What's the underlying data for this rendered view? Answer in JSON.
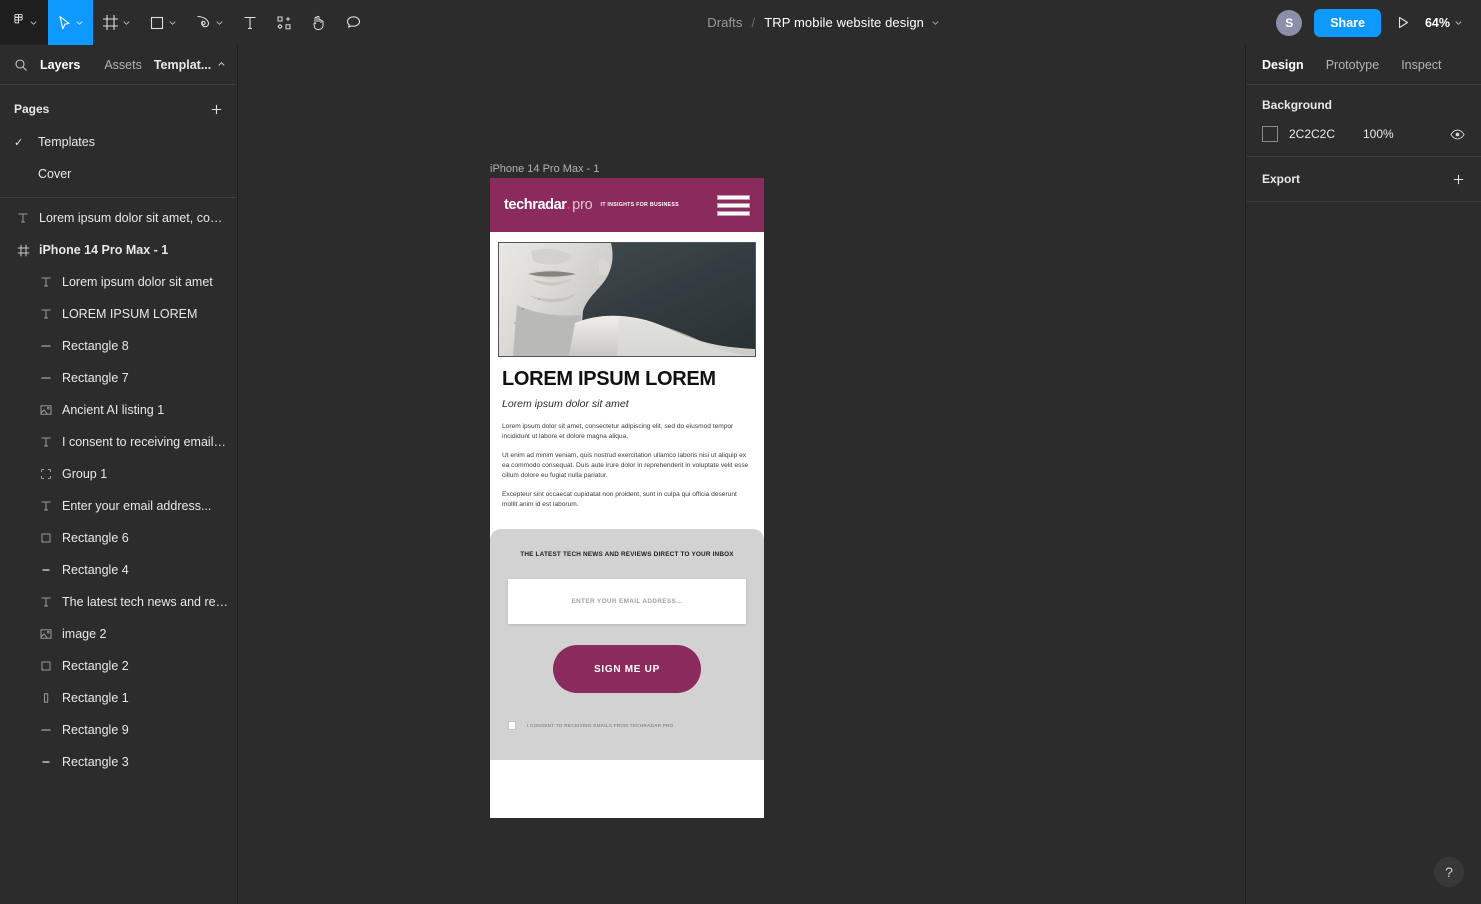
{
  "toolbar": {
    "tools": [
      {
        "name": "figma-menu-icon",
        "label": "Figma menu"
      },
      {
        "name": "move-tool-icon",
        "label": "Move"
      },
      {
        "name": "frame-tool-icon",
        "label": "Frame"
      },
      {
        "name": "shape-tool-icon",
        "label": "Rectangle"
      },
      {
        "name": "pen-tool-icon",
        "label": "Pen"
      },
      {
        "name": "text-tool-icon",
        "label": "Text"
      },
      {
        "name": "resources-icon",
        "label": "Resources"
      },
      {
        "name": "hand-tool-icon",
        "label": "Hand"
      },
      {
        "name": "comment-tool-icon",
        "label": "Comment"
      }
    ],
    "breadcrumb_root": "Drafts",
    "breadcrumb_separator": "/",
    "file_name": "TRP mobile website design",
    "avatar_initial": "S",
    "share_label": "Share",
    "zoom_level": "64%",
    "accent_color": "#0d99ff"
  },
  "left_panel": {
    "tabs": [
      {
        "label": "Layers",
        "active": true
      },
      {
        "label": "Assets",
        "active": false
      }
    ],
    "template_tab": "Templat...",
    "pages_title": "Pages",
    "pages": [
      {
        "label": "Templates",
        "selected": true
      },
      {
        "label": "Cover",
        "selected": false
      }
    ],
    "layers": [
      {
        "label": "Lorem ipsum dolor sit amet, conse...",
        "icon": "text-layer-icon",
        "depth": 0,
        "bold": false
      },
      {
        "label": "iPhone 14 Pro Max - 1",
        "icon": "frame-layer-icon",
        "depth": 0,
        "bold": true
      },
      {
        "label": "Lorem ipsum dolor sit amet",
        "icon": "text-layer-icon",
        "depth": 1,
        "bold": false
      },
      {
        "label": "LOREM IPSUM LOREM",
        "icon": "text-layer-icon",
        "depth": 1,
        "bold": false
      },
      {
        "label": "Rectangle 8",
        "icon": "line-layer-icon",
        "depth": 1,
        "bold": false
      },
      {
        "label": "Rectangle 7",
        "icon": "line-layer-icon",
        "depth": 1,
        "bold": false
      },
      {
        "label": "Ancient AI listing 1",
        "icon": "image-layer-icon",
        "depth": 1,
        "bold": false
      },
      {
        "label": "I consent to receiving emails ...",
        "icon": "text-layer-icon",
        "depth": 1,
        "bold": false
      },
      {
        "label": "Group 1",
        "icon": "group-layer-icon",
        "depth": 1,
        "bold": false
      },
      {
        "label": "Enter your email address...",
        "icon": "text-layer-icon",
        "depth": 1,
        "bold": false
      },
      {
        "label": "Rectangle 6",
        "icon": "rect-layer-icon",
        "depth": 1,
        "bold": false
      },
      {
        "label": "Rectangle 4",
        "icon": "line-layer-icon",
        "depth": 1,
        "bold": false
      },
      {
        "label": "The latest tech news and revi...",
        "icon": "text-layer-icon",
        "depth": 1,
        "bold": false
      },
      {
        "label": "image 2",
        "icon": "image-layer-icon",
        "depth": 1,
        "bold": false
      },
      {
        "label": "Rectangle 2",
        "icon": "rect-layer-icon",
        "depth": 1,
        "bold": false
      },
      {
        "label": "Rectangle 1",
        "icon": "tallrect-layer-icon",
        "depth": 1,
        "bold": false
      },
      {
        "label": "Rectangle 9",
        "icon": "line-layer-icon",
        "depth": 1,
        "bold": false
      },
      {
        "label": "Rectangle 3",
        "icon": "line-layer-icon",
        "depth": 1,
        "bold": false
      }
    ]
  },
  "right_panel": {
    "tabs": [
      {
        "label": "Design",
        "active": true
      },
      {
        "label": "Prototype",
        "active": false
      },
      {
        "label": "Inspect",
        "active": false
      }
    ],
    "background": {
      "title": "Background",
      "hex": "2C2C2C",
      "opacity": "100%"
    },
    "export": {
      "title": "Export"
    }
  },
  "canvas": {
    "frame_label": "iPhone 14 Pro Max - 1",
    "brand_color": "#8b2a5c",
    "design": {
      "logo_main": "techradar",
      "logo_dot": ".",
      "logo_pro": "pro",
      "logo_tagline": "IT INSIGHTS FOR BUSINESS",
      "headline": "LOREM IPSUM LOREM",
      "subhead": "Lorem ipsum dolor sit amet",
      "paragraphs": [
        "Lorem ipsum dolor sit amet, consectetur adipiscing elit, sed do eiusmod tempor incididunt ut labore et dolore magna aliqua.",
        "Ut enim ad minim veniam, quis nostrud exercitation ullamco laboris nisi ut aliquip ex ea commodo consequat. Duis aute irure dolor in reprehenderit in voluptate velit esse cillum dolore eu fugiat nulla pariatur.",
        "Excepteur sint occaecat cupidatat non proident, sunt in culpa qui officia deserunt mollit anim id est laborum."
      ],
      "newsletter_heading": "THE LATEST TECH NEWS AND REVIEWS DIRECT TO YOUR INBOX",
      "email_placeholder": "ENTER YOUR EMAIL ADDRESS...",
      "signup_label": "SIGN ME UP",
      "consent_label": "I CONSENT TO RECEIVING EMAILS FROM TECHRADAR PRO"
    }
  },
  "help": {
    "label": "?"
  }
}
